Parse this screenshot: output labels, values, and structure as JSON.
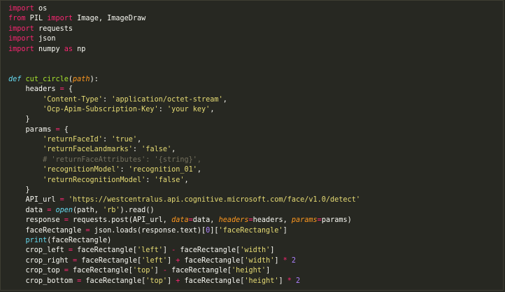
{
  "editor": {
    "lines": [
      [
        {
          "t": "import",
          "c": "kw"
        },
        {
          "t": " os",
          "c": "plain"
        }
      ],
      [
        {
          "t": "from",
          "c": "kw"
        },
        {
          "t": " PIL ",
          "c": "plain"
        },
        {
          "t": "import",
          "c": "kw"
        },
        {
          "t": " Image, ImageDraw",
          "c": "plain"
        }
      ],
      [
        {
          "t": "import",
          "c": "kw"
        },
        {
          "t": " requests",
          "c": "plain"
        }
      ],
      [
        {
          "t": "import",
          "c": "kw"
        },
        {
          "t": " json",
          "c": "plain"
        }
      ],
      [
        {
          "t": "import",
          "c": "kw"
        },
        {
          "t": " numpy ",
          "c": "plain"
        },
        {
          "t": "as",
          "c": "kw"
        },
        {
          "t": " np",
          "c": "plain"
        }
      ],
      [],
      [],
      [
        {
          "t": "def",
          "c": "def"
        },
        {
          "t": " ",
          "c": "plain"
        },
        {
          "t": "cut_circle",
          "c": "fn"
        },
        {
          "t": "(",
          "c": "plain"
        },
        {
          "t": "path",
          "c": "param"
        },
        {
          "t": "):",
          "c": "plain"
        }
      ],
      [
        {
          "t": "    headers ",
          "c": "plain"
        },
        {
          "t": "=",
          "c": "op"
        },
        {
          "t": " {",
          "c": "plain"
        }
      ],
      [
        {
          "t": "        ",
          "c": "plain"
        },
        {
          "t": "'Content-Type'",
          "c": "str"
        },
        {
          "t": ": ",
          "c": "plain"
        },
        {
          "t": "'application/octet-stream'",
          "c": "str"
        },
        {
          "t": ",",
          "c": "plain"
        }
      ],
      [
        {
          "t": "        ",
          "c": "plain"
        },
        {
          "t": "'Ocp-Apim-Subscription-Key'",
          "c": "str"
        },
        {
          "t": ": ",
          "c": "plain"
        },
        {
          "t": "'your key'",
          "c": "str"
        },
        {
          "t": ",",
          "c": "plain"
        }
      ],
      [
        {
          "t": "    }",
          "c": "plain"
        }
      ],
      [
        {
          "t": "    params ",
          "c": "plain"
        },
        {
          "t": "=",
          "c": "op"
        },
        {
          "t": " {",
          "c": "plain"
        }
      ],
      [
        {
          "t": "        ",
          "c": "plain"
        },
        {
          "t": "'returnFaceId'",
          "c": "str"
        },
        {
          "t": ": ",
          "c": "plain"
        },
        {
          "t": "'true'",
          "c": "str"
        },
        {
          "t": ",",
          "c": "plain"
        }
      ],
      [
        {
          "t": "        ",
          "c": "plain"
        },
        {
          "t": "'returnFaceLandmarks'",
          "c": "str"
        },
        {
          "t": ": ",
          "c": "plain"
        },
        {
          "t": "'false'",
          "c": "str"
        },
        {
          "t": ",",
          "c": "plain"
        }
      ],
      [
        {
          "t": "        ",
          "c": "plain"
        },
        {
          "t": "# 'returnFaceAttributes': '{string}',",
          "c": "cmt"
        }
      ],
      [
        {
          "t": "        ",
          "c": "plain"
        },
        {
          "t": "'recognitionModel'",
          "c": "str"
        },
        {
          "t": ": ",
          "c": "plain"
        },
        {
          "t": "'recognition_01'",
          "c": "str"
        },
        {
          "t": ",",
          "c": "plain"
        }
      ],
      [
        {
          "t": "        ",
          "c": "plain"
        },
        {
          "t": "'returnRecognitionModel'",
          "c": "str"
        },
        {
          "t": ": ",
          "c": "plain"
        },
        {
          "t": "'false'",
          "c": "str"
        },
        {
          "t": ",",
          "c": "plain"
        }
      ],
      [
        {
          "t": "    }",
          "c": "plain"
        }
      ],
      [
        {
          "t": "    API_url ",
          "c": "plain"
        },
        {
          "t": "=",
          "c": "op"
        },
        {
          "t": " ",
          "c": "plain"
        },
        {
          "t": "'https://westcentralus.api.cognitive.microsoft.com/face/v1.0/detect'",
          "c": "str"
        }
      ],
      [
        {
          "t": "    data ",
          "c": "plain"
        },
        {
          "t": "=",
          "c": "op"
        },
        {
          "t": " ",
          "c": "plain"
        },
        {
          "t": "open",
          "c": "def"
        },
        {
          "t": "(path, ",
          "c": "plain"
        },
        {
          "t": "'rb'",
          "c": "str"
        },
        {
          "t": ").read()",
          "c": "plain"
        }
      ],
      [
        {
          "t": "    response ",
          "c": "plain"
        },
        {
          "t": "=",
          "c": "op"
        },
        {
          "t": " requests.post(API_url, ",
          "c": "plain"
        },
        {
          "t": "data",
          "c": "kwarg"
        },
        {
          "t": "=",
          "c": "op"
        },
        {
          "t": "data, ",
          "c": "plain"
        },
        {
          "t": "headers",
          "c": "kwarg"
        },
        {
          "t": "=",
          "c": "op"
        },
        {
          "t": "headers, ",
          "c": "plain"
        },
        {
          "t": "params",
          "c": "kwarg"
        },
        {
          "t": "=",
          "c": "op"
        },
        {
          "t": "params)",
          "c": "plain"
        }
      ],
      [
        {
          "t": "    faceRectangle ",
          "c": "plain"
        },
        {
          "t": "=",
          "c": "op"
        },
        {
          "t": " json.loads(response.text)[",
          "c": "plain"
        },
        {
          "t": "0",
          "c": "num"
        },
        {
          "t": "][",
          "c": "plain"
        },
        {
          "t": "'faceRectangle'",
          "c": "str"
        },
        {
          "t": "]",
          "c": "plain"
        }
      ],
      [
        {
          "t": "    ",
          "c": "plain"
        },
        {
          "t": "print",
          "c": "builtin"
        },
        {
          "t": "(faceRectangle)",
          "c": "plain"
        }
      ],
      [
        {
          "t": "    crop_left ",
          "c": "plain"
        },
        {
          "t": "=",
          "c": "op"
        },
        {
          "t": " faceRectangle[",
          "c": "plain"
        },
        {
          "t": "'left'",
          "c": "str"
        },
        {
          "t": "] ",
          "c": "plain"
        },
        {
          "t": "-",
          "c": "op"
        },
        {
          "t": " faceRectangle[",
          "c": "plain"
        },
        {
          "t": "'width'",
          "c": "str"
        },
        {
          "t": "]",
          "c": "plain"
        }
      ],
      [
        {
          "t": "    crop_right ",
          "c": "plain"
        },
        {
          "t": "=",
          "c": "op"
        },
        {
          "t": " faceRectangle[",
          "c": "plain"
        },
        {
          "t": "'left'",
          "c": "str"
        },
        {
          "t": "] ",
          "c": "plain"
        },
        {
          "t": "+",
          "c": "op"
        },
        {
          "t": " faceRectangle[",
          "c": "plain"
        },
        {
          "t": "'width'",
          "c": "str"
        },
        {
          "t": "] ",
          "c": "plain"
        },
        {
          "t": "*",
          "c": "op"
        },
        {
          "t": " ",
          "c": "plain"
        },
        {
          "t": "2",
          "c": "num"
        }
      ],
      [
        {
          "t": "    crop_top ",
          "c": "plain"
        },
        {
          "t": "=",
          "c": "op"
        },
        {
          "t": " faceRectangle[",
          "c": "plain"
        },
        {
          "t": "'top'",
          "c": "str"
        },
        {
          "t": "] ",
          "c": "plain"
        },
        {
          "t": "-",
          "c": "op"
        },
        {
          "t": " faceRectangle[",
          "c": "plain"
        },
        {
          "t": "'height'",
          "c": "str"
        },
        {
          "t": "]",
          "c": "plain"
        }
      ],
      [
        {
          "t": "    crop_bottom ",
          "c": "plain"
        },
        {
          "t": "=",
          "c": "op"
        },
        {
          "t": " faceRectangle[",
          "c": "plain"
        },
        {
          "t": "'top'",
          "c": "str"
        },
        {
          "t": "] ",
          "c": "plain"
        },
        {
          "t": "+",
          "c": "op"
        },
        {
          "t": " faceRectangle[",
          "c": "plain"
        },
        {
          "t": "'height'",
          "c": "str"
        },
        {
          "t": "] ",
          "c": "plain"
        },
        {
          "t": "*",
          "c": "op"
        },
        {
          "t": " ",
          "c": "plain"
        },
        {
          "t": "2",
          "c": "num"
        }
      ]
    ]
  }
}
